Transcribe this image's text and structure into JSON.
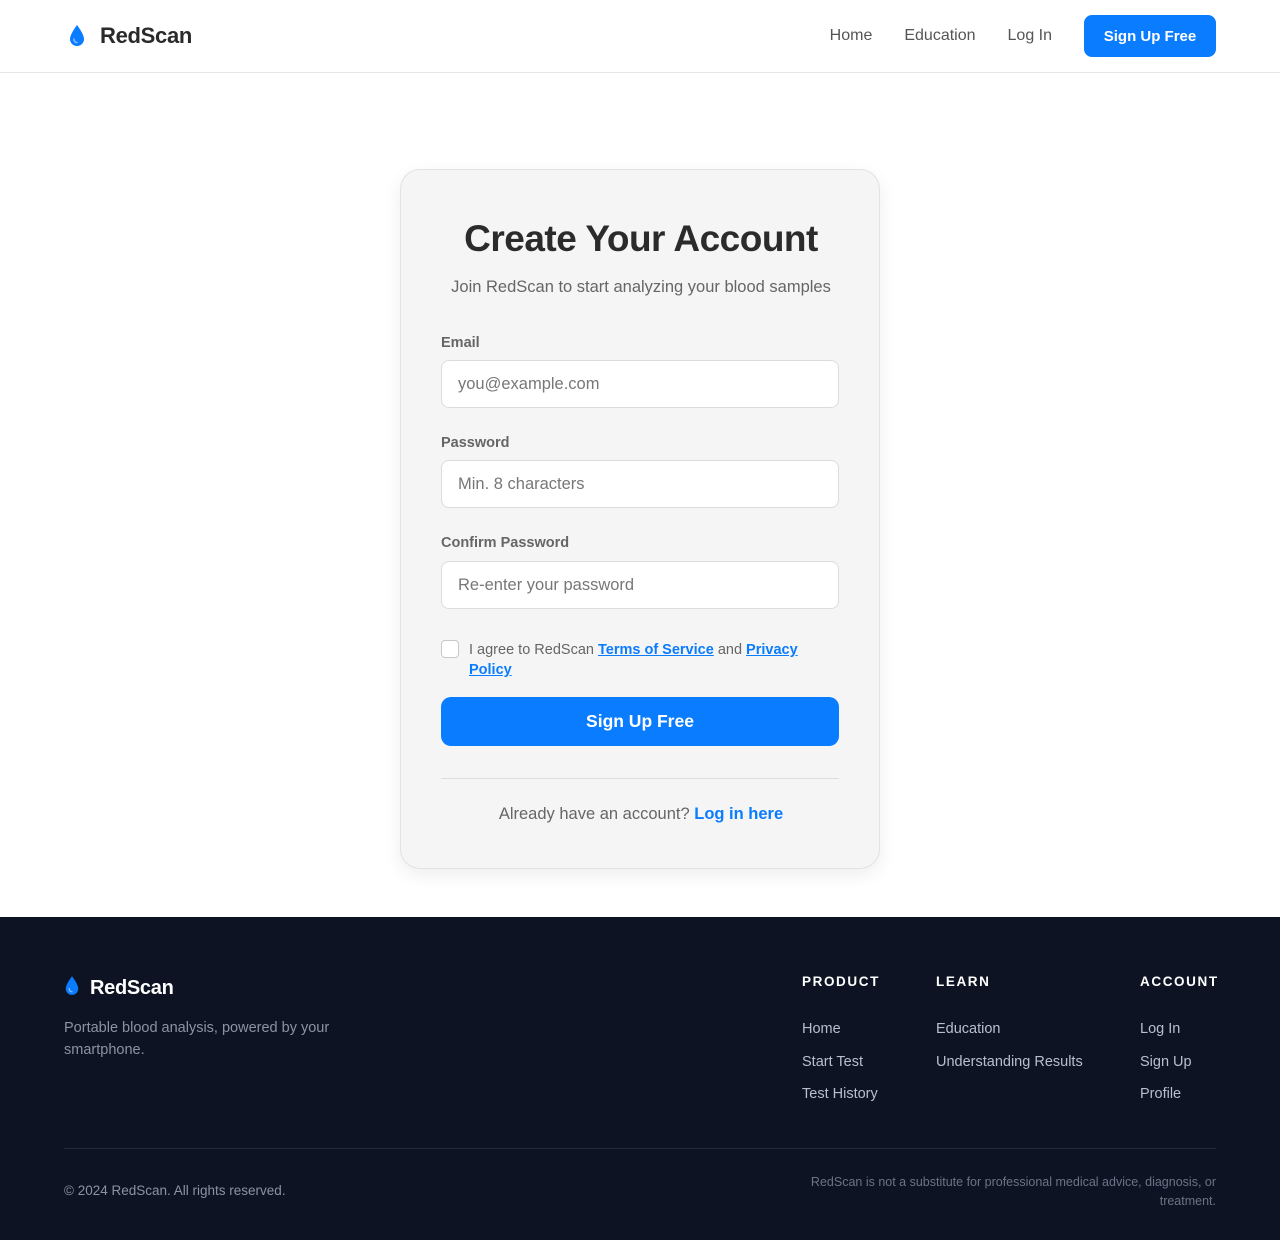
{
  "brand": {
    "name": "RedScan",
    "accent_color": "#0a7cff",
    "logo_icon": "droplet-icon"
  },
  "header": {
    "nav": [
      {
        "label": "Home"
      },
      {
        "label": "Education"
      },
      {
        "label": "Log In"
      }
    ],
    "cta_label": "Sign Up Free"
  },
  "form": {
    "title": "Create Your Account",
    "subtitle": "Join RedScan to start analyzing your blood samples",
    "email": {
      "label": "Email",
      "placeholder": "you@example.com",
      "value": ""
    },
    "password": {
      "label": "Password",
      "placeholder": "Min. 8 characters",
      "value": ""
    },
    "confirm": {
      "label": "Confirm Password",
      "placeholder": "Re-enter your password",
      "value": ""
    },
    "agree": {
      "checked": false,
      "prefix": "I agree to RedScan",
      "terms_link": "Terms of Service",
      "conjunction": "and",
      "privacy_link": "Privacy Policy"
    },
    "submit_label": "Sign Up Free",
    "login_prompt": "Already have an account?",
    "login_link": "Log in here"
  },
  "footer": {
    "brand_name": "RedScan",
    "tagline": "Portable blood analysis, powered by your smartphone.",
    "columns": [
      {
        "heading": "PRODUCT",
        "links": [
          "Home",
          "Start Test",
          "Test History"
        ]
      },
      {
        "heading": "LEARN",
        "links": [
          "Education",
          "Understanding Results"
        ]
      },
      {
        "heading": "ACCOUNT",
        "links": [
          "Log In",
          "Sign Up",
          "Profile"
        ]
      }
    ],
    "copyright": "© 2024 RedScan. All rights reserved.",
    "disclaimer": "RedScan is not a substitute for professional medical advice, diagnosis, or treatment.",
    "background_color": "#0d1322"
  }
}
